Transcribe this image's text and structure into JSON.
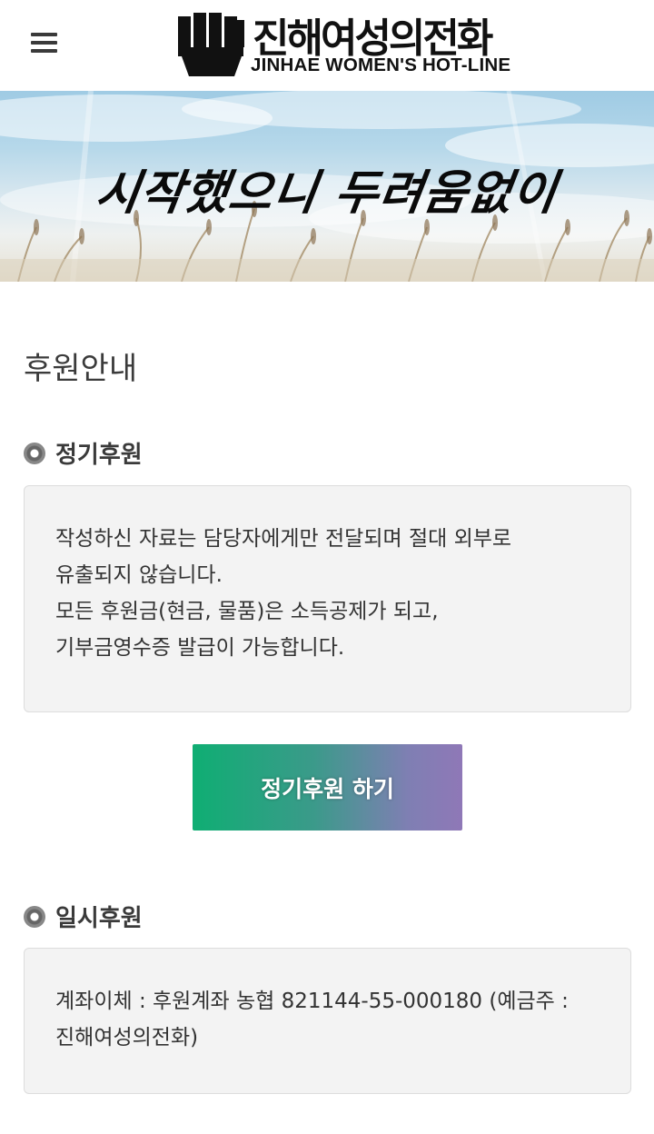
{
  "header": {
    "logo_korean": "진해여성의전화",
    "logo_english": "JINHAE WOMEN'S HOT-LINE"
  },
  "banner": {
    "slogan": "시작했으니 두려움없이"
  },
  "page": {
    "title": "후원안내"
  },
  "regular": {
    "heading": "정기후원",
    "lines": [
      "작성하신 자료는 담당자에게만 전달되며 절대 외부로",
      "유출되지 않습니다.",
      "모든 후원금(현금, 물품)은 소득공제가 되고,",
      "기부금영수증 발급이 가능합니다."
    ],
    "button_label": "정기후원 하기"
  },
  "onetime": {
    "heading": "일시후원",
    "lines": [
      "계좌이체 : 후원계좌 농협 821144-55-000180 (예금주 :",
      "진해여성의전화)"
    ]
  },
  "colors": {
    "button_gradient_start": "#0fae73",
    "button_gradient_end": "#8f78b7",
    "box_background": "#f3f3f3"
  }
}
